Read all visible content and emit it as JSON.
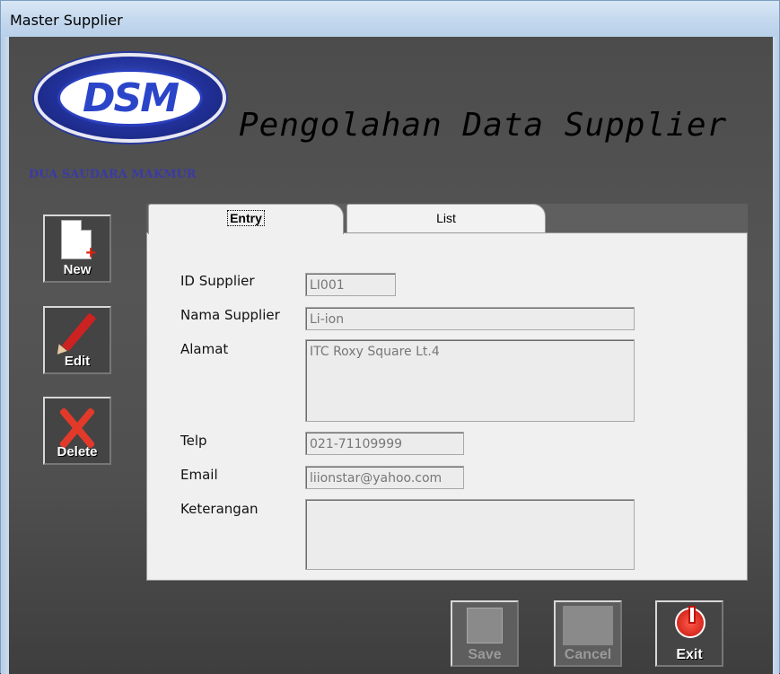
{
  "window": {
    "title": "Master Supplier"
  },
  "logo": {
    "letters": "DSM",
    "caption": "DUA SAUDARA MAKMUR"
  },
  "heading": "Pengolahan Data Supplier",
  "side_buttons": {
    "new": "New",
    "edit": "Edit",
    "delete": "Delete"
  },
  "tabs": [
    {
      "label": "Entry",
      "active": true
    },
    {
      "label": "List",
      "active": false
    }
  ],
  "form": {
    "id_supplier": {
      "label": "ID Supplier",
      "value": "LI001"
    },
    "nama_supplier": {
      "label": "Nama Supplier",
      "value": "Li-ion"
    },
    "alamat": {
      "label": "Alamat",
      "value": "ITC Roxy Square Lt.4"
    },
    "telp": {
      "label": "Telp",
      "value": "021-71109999"
    },
    "email": {
      "label": "Email",
      "value": "liionstar@yahoo.com"
    },
    "keterangan": {
      "label": "Keterangan",
      "value": ""
    }
  },
  "bottom_buttons": {
    "save": "Save",
    "cancel": "Cancel",
    "exit": "Exit"
  },
  "colors": {
    "logo_blue": "#2b45c9",
    "exit_red": "#e0261a",
    "delete_red": "#e23a2a"
  },
  "icons": {
    "new": "new-document-icon",
    "edit": "pencil-icon",
    "delete": "delete-x-icon",
    "save": "save-icon",
    "cancel": "cancel-icon",
    "exit": "power-icon"
  }
}
